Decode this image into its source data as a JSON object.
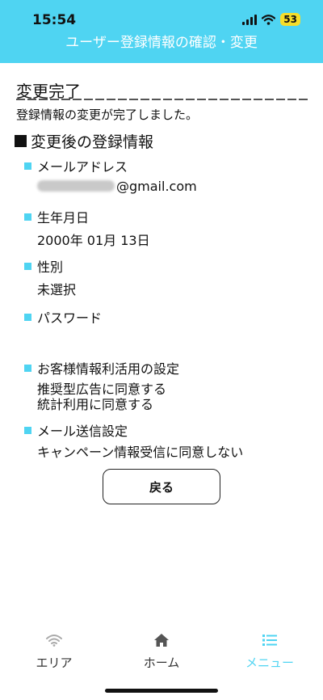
{
  "status": {
    "time": "15:54",
    "battery": "53"
  },
  "header": {
    "title": "ユーザー登録情報の確認・変更"
  },
  "done": {
    "title": "変更完了",
    "message": "登録情報の変更が完了しました。"
  },
  "section": {
    "title": "変更後の登録情報"
  },
  "items": {
    "email": {
      "label": "メールアドレス",
      "value_suffix": "@gmail.com"
    },
    "birthday": {
      "label": "生年月日",
      "value": "2000年 01月 13日"
    },
    "gender": {
      "label": "性別",
      "value": "未選択"
    },
    "password": {
      "label": "パスワード"
    },
    "usage": {
      "label": "お客様情報利活用の設定",
      "value1": "推奨型広告に同意する",
      "value2": "統計利用に同意する"
    },
    "mail": {
      "label": "メール送信設定",
      "value": "キャンペーン情報受信に同意しない"
    }
  },
  "buttons": {
    "back": "戻る"
  },
  "tabs": {
    "area": "エリア",
    "home": "ホーム",
    "menu": "メニュー"
  },
  "colors": {
    "accent": "#4fd4f2",
    "tab_active": "#4fd4f2",
    "tab_inactive": "#333333",
    "battery": "#f6dd2a"
  }
}
